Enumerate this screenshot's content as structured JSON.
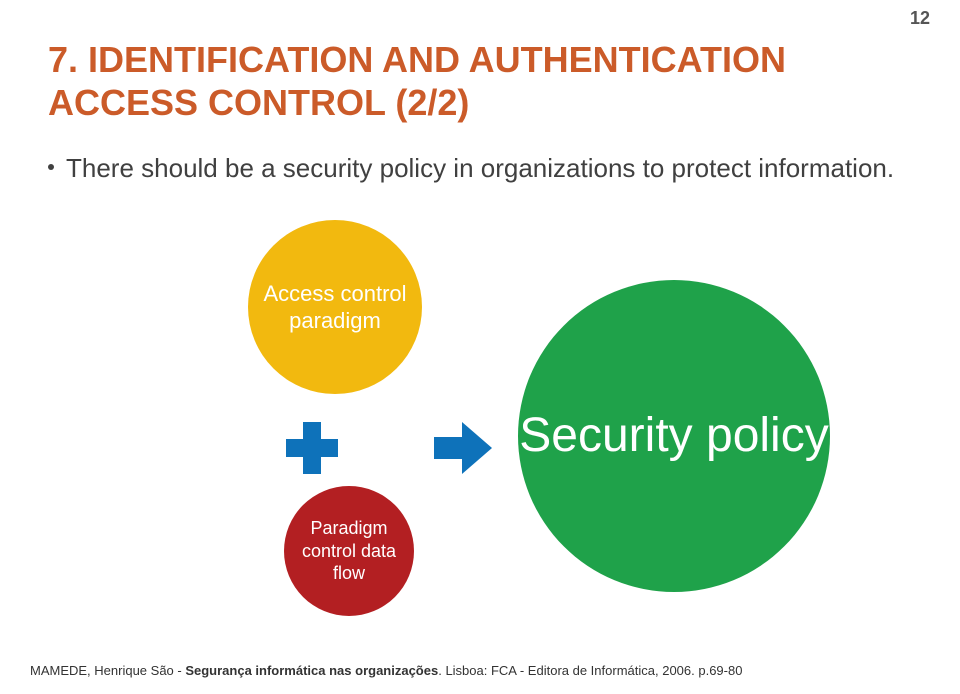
{
  "page_number": "12",
  "title": "7. IDENTIFICATION AND AUTHENTICATION ACCESS CONTROL (2/2)",
  "bullet": "There should be a security policy in organizations to protect information.",
  "diagram": {
    "yellow": "Access control paradigm",
    "red": "Paradigm control data flow",
    "green": "Security policy"
  },
  "citation": {
    "author": "MAMEDE, Henrique São - ",
    "work": "Segurança informática nas organizações",
    "rest": ". Lisboa: FCA - Editora de Informática, 2006. p.69-80"
  }
}
